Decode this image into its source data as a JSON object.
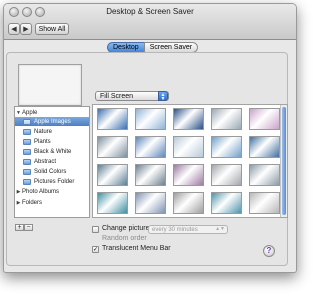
{
  "window": {
    "title": "Desktop & Screen Saver"
  },
  "toolbar": {
    "back": "◀",
    "forward": "▶",
    "show_all": "Show All"
  },
  "tabs": [
    {
      "label": "Desktop",
      "active": true
    },
    {
      "label": "Screen Saver",
      "active": false
    }
  ],
  "fit_popup": {
    "value": "Fill Screen",
    "arrows": "▲\n▼"
  },
  "sidebar": {
    "groups": [
      {
        "label": "Apple",
        "expanded": true,
        "items": [
          {
            "label": "Apple Images",
            "selected": true
          },
          {
            "label": "Nature"
          },
          {
            "label": "Plants"
          },
          {
            "label": "Black & White"
          },
          {
            "label": "Abstract"
          },
          {
            "label": "Solid Colors"
          },
          {
            "label": "Pictures Folder"
          }
        ]
      },
      {
        "label": "Photo Albums",
        "expanded": false
      },
      {
        "label": "Folders",
        "expanded": false
      }
    ],
    "disclosure_open": "▼",
    "disclosure_closed": "▶"
  },
  "controls": {
    "add": "+",
    "remove": "−",
    "change_picture_label": "Change picture:",
    "change_picture_checked": false,
    "interval_value": "every 30 minutes",
    "random_order_label": "Random order",
    "translucent_label": "Translucent Menu Bar",
    "translucent_checked": true,
    "checkmark": "✓",
    "help": "?"
  },
  "wallpapers": [
    [
      "#3a6fb0",
      "#8fb3d6",
      "#2a4f88",
      "#9aa7b3",
      "#c9a3c8"
    ],
    [
      "#7d8f9c",
      "#5f86b9",
      "#b8c9d8",
      "#6f9fc9",
      "#3f6f9f"
    ],
    [
      "#5d7f94",
      "#6d7f8d",
      "#9c7aa0",
      "#a2a6ab",
      "#8d9aa5"
    ],
    [
      "#3f8fa0",
      "#7f92b0",
      "#9e9e9e",
      "#4f93a8",
      "#b7b7b7"
    ]
  ],
  "colors": {
    "accent": "#3f86dd",
    "selection": "#4b7fc5"
  }
}
